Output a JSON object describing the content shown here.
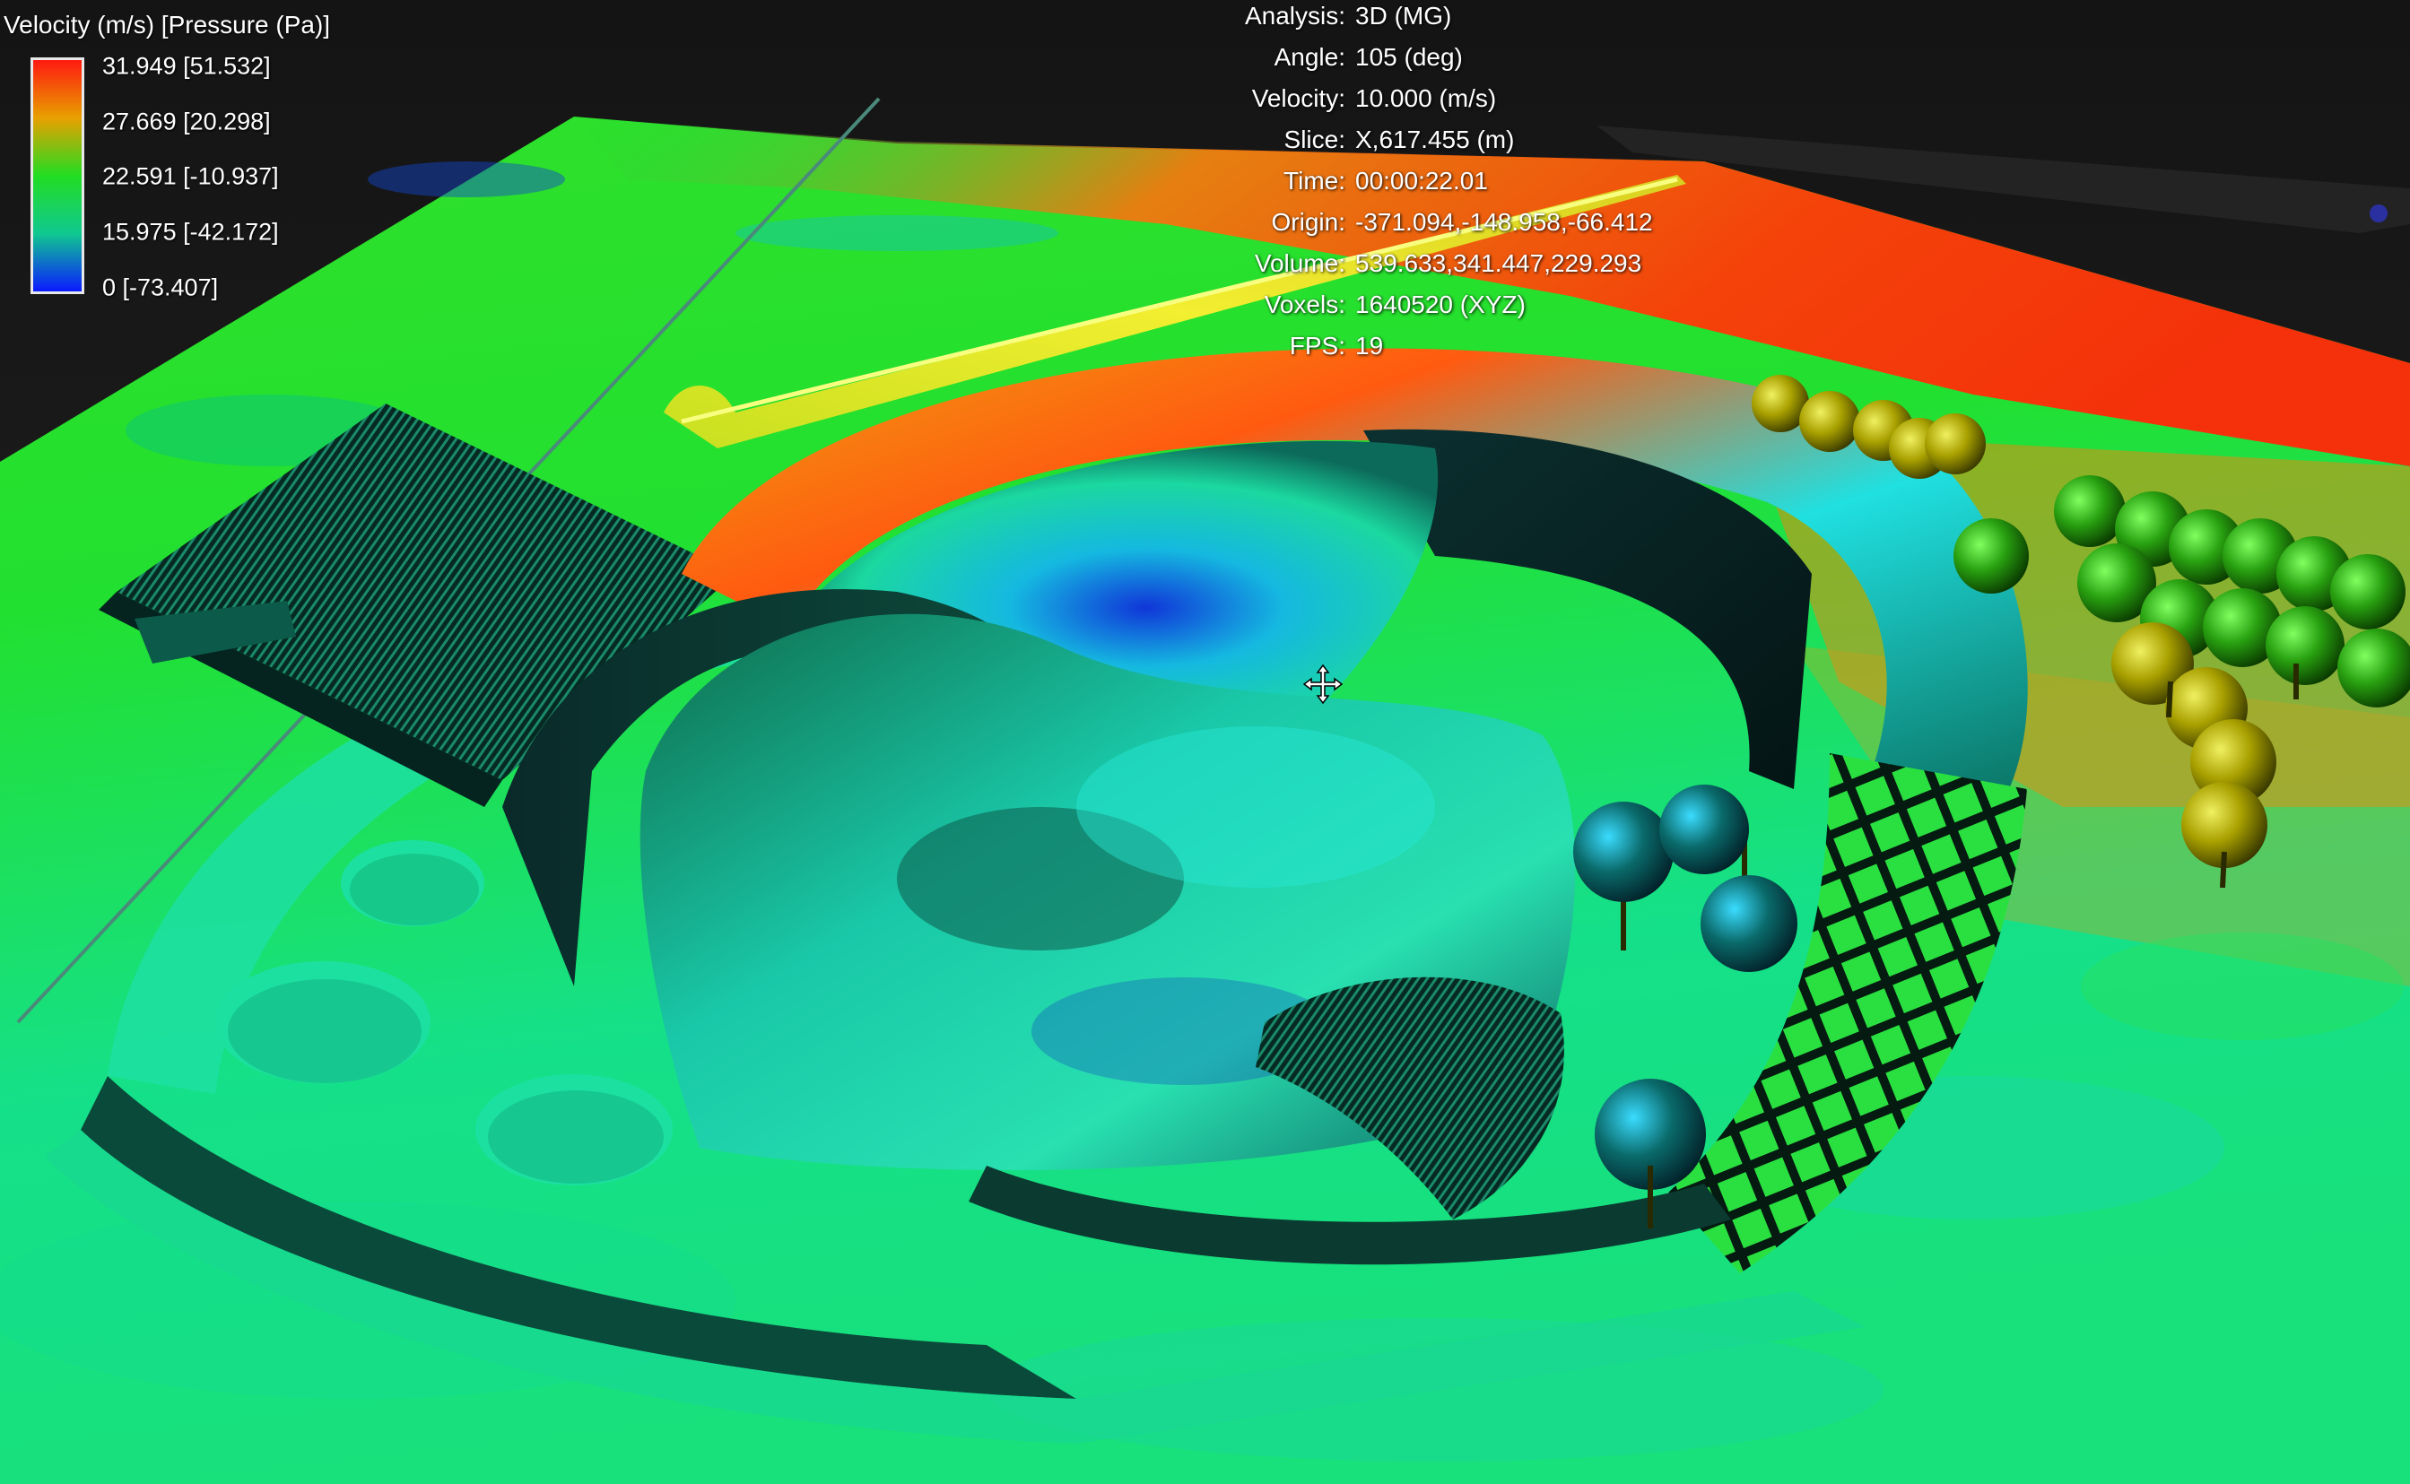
{
  "legend": {
    "title": "Velocity (m/s) [Pressure (Pa)]",
    "labels": [
      "31.949 [51.532]",
      "27.669 [20.298]",
      "22.591 [-10.937]",
      "15.975 [-42.172]",
      "0 [-73.407]"
    ],
    "colors": [
      "#ff1a10",
      "#e8a000",
      "#22dd22",
      "#10c890",
      "#0b1aff"
    ]
  },
  "info": {
    "analysis_key": "Analysis:",
    "analysis_val": "3D (MG)",
    "angle_key": "Angle:",
    "angle_val": "105 (deg)",
    "velocity_key": "Velocity:",
    "velocity_val": "10.000 (m/s)",
    "slice_key": "Slice:",
    "slice_val": "X,617.455 (m)",
    "time_key": "Time:",
    "time_val": "00:00:22.01",
    "origin_key": "Origin:",
    "origin_val": "-371.094,-148.958,-66.412",
    "volume_key": "Volume:",
    "volume_val": "539.633,341.447,229.293",
    "voxels_key": "Voxels:",
    "voxels_val": "1640520 (XYZ)",
    "fps_key": "FPS:",
    "fps_val": "19"
  },
  "scene": {
    "icon": "move-cursor-icon",
    "palette": {
      "background": "#191919",
      "high": "#ff2a0a",
      "mid_high": "#f08a00",
      "mid": "#22e22a",
      "low_mid": "#12e2a0",
      "low": "#1030ff",
      "tree": "#b8a800"
    }
  }
}
